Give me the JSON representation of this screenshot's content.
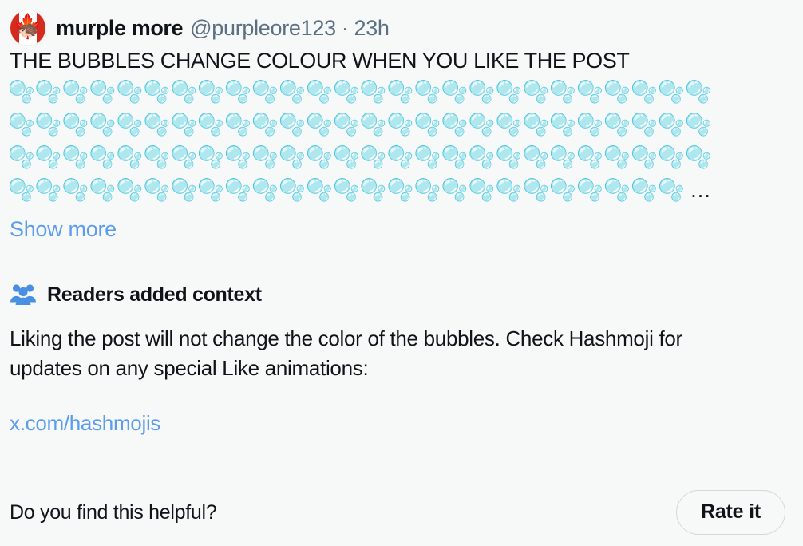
{
  "post": {
    "author": {
      "display_name": "murple more",
      "handle": "@purpleore123",
      "separator": "·",
      "timestamp": "23h",
      "avatar_icon": "canada-flag-avatar",
      "avatar_leaf_glyph": "🍁",
      "avatar_critter_glyph": "🦔"
    },
    "text": "THE BUBBLES CHANGE COLOUR WHEN YOU LIKE THE POST",
    "bubble_emoji": "🫧",
    "bubble_rows": [
      "🫧🫧🫧🫧🫧🫧🫧🫧🫧🫧🫧🫧🫧🫧🫧🫧🫧🫧🫧🫧🫧🫧🫧🫧🫧🫧",
      "🫧🫧🫧🫧🫧🫧🫧🫧🫧🫧🫧🫧🫧🫧🫧🫧🫧🫧🫧🫧🫧🫧🫧🫧🫧🫧",
      "🫧🫧🫧🫧🫧🫧🫧🫧🫧🫧🫧🫧🫧🫧🫧🫧🫧🫧🫧🫧🫧🫧🫧🫧🫧🫧",
      "🫧🫧🫧🫧🫧🫧🫧🫧🫧🫧🫧🫧🫧🫧🫧🫧🫧🫧🫧🫧🫧🫧🫧🫧🫧"
    ],
    "truncation_ellipsis": "…",
    "show_more_label": "Show more"
  },
  "community_note": {
    "icon": "people-group-icon",
    "title": "Readers added context",
    "body": "Liking the post will not change the color of the bubbles. Check Hashmoji for updates on any special Like animations:",
    "link_text": "x.com/hashmojis"
  },
  "footer": {
    "helpful_question": "Do you find this helpful?",
    "rate_button_label": "Rate it"
  },
  "colors": {
    "background": "#f7f8f8",
    "text_primary": "#0f1419",
    "text_secondary": "#5b7083",
    "link_blue": "#5b9bf0",
    "accent_blue": "#4a90e2",
    "divider": "#cfd9de",
    "border": "#cfd9de",
    "flag_red": "#d52b1e"
  }
}
